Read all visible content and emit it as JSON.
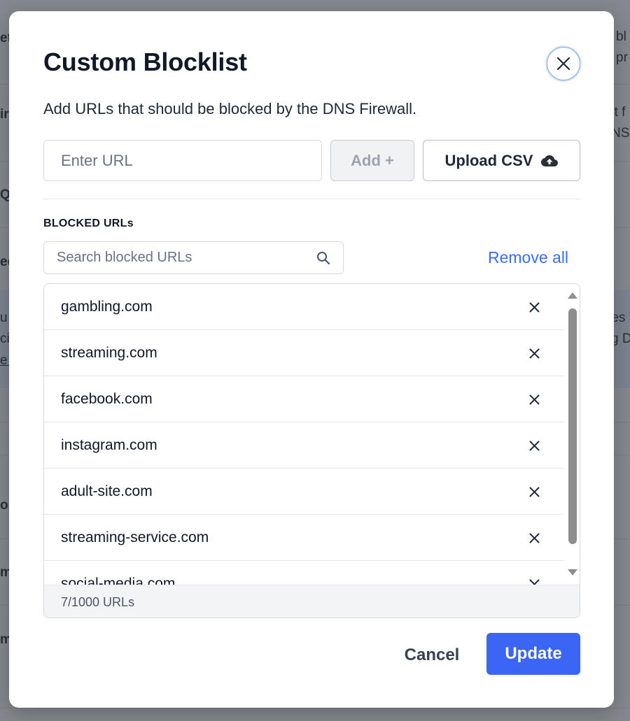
{
  "background": {
    "fragments": [
      "et",
      "bl",
      "pr",
      "ir",
      "nt f",
      "NS",
      "Q",
      "ec",
      "u",
      "res",
      "cit",
      "g D",
      "e l",
      "on",
      "m",
      "m"
    ]
  },
  "modal": {
    "title": "Custom Blocklist",
    "subtitle": "Add URLs that should be blocked by the DNS Firewall.",
    "url_input": {
      "value": "",
      "placeholder": "Enter URL"
    },
    "add_label": "Add +",
    "upload_label": "Upload CSV",
    "section_label": "BLOCKED URLs",
    "search": {
      "value": "",
      "placeholder": "Search blocked URLs"
    },
    "remove_all_label": "Remove all",
    "blocked_urls": [
      "gambling.com",
      "streaming.com",
      "facebook.com",
      "instagram.com",
      "adult-site.com",
      "streaming-service.com",
      "social-media.com"
    ],
    "count_label": "7/1000 URLs",
    "cancel_label": "Cancel",
    "update_label": "Update"
  },
  "colors": {
    "accent": "#3b66f5",
    "link": "#3b6ef5",
    "title_text": "#111827"
  },
  "icons": {
    "close": "close-icon",
    "upload": "cloud-upload-icon",
    "search": "search-icon",
    "remove_item": "close-icon"
  }
}
